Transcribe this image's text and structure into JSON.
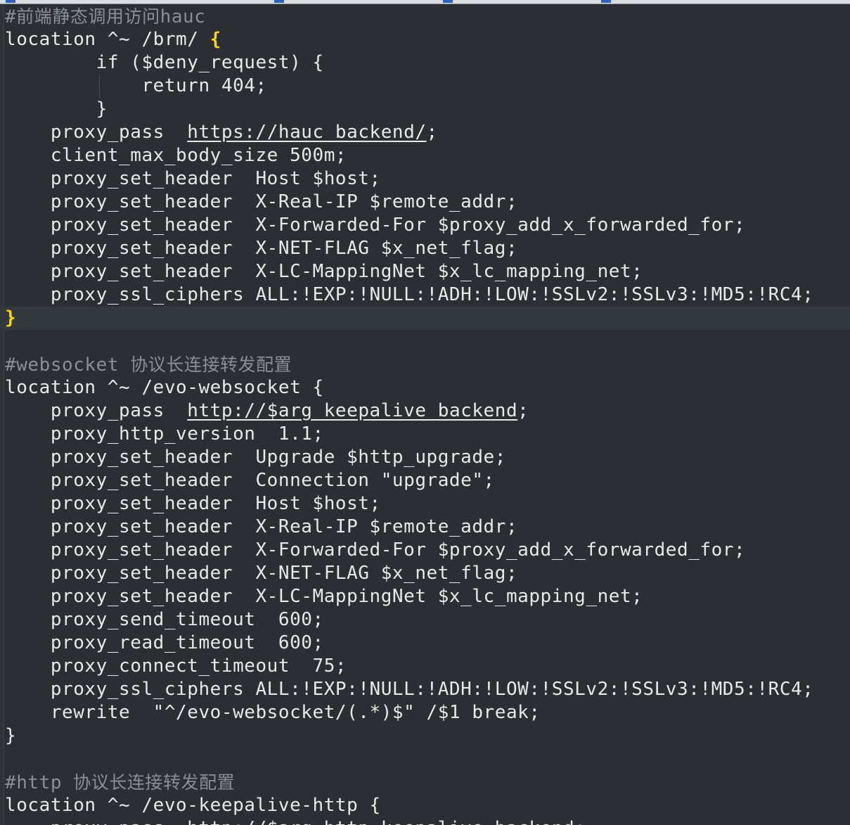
{
  "editor": {
    "lines": [
      {
        "parts": [
          {
            "t": "#",
            "c": "comment"
          },
          {
            "t": "前端静态调用访问",
            "c": "comment-cjk"
          },
          {
            "t": "hauc",
            "c": "comment"
          }
        ]
      },
      {
        "parts": [
          {
            "t": "location ^~ /brm/ "
          },
          {
            "t": "{",
            "c": "brace-hl"
          }
        ]
      },
      {
        "parts": [
          {
            "t": "        if ($deny_request) {"
          }
        ]
      },
      {
        "parts": [
          {
            "t": "            return 404;"
          }
        ]
      },
      {
        "parts": [
          {
            "t": "        }"
          }
        ]
      },
      {
        "parts": [
          {
            "t": "    proxy_pass  "
          },
          {
            "t": "https://hauc_backend/",
            "c": "url"
          },
          {
            "t": ";"
          }
        ]
      },
      {
        "parts": [
          {
            "t": "    client_max_body_size 500m;"
          }
        ]
      },
      {
        "parts": [
          {
            "t": "    proxy_set_header  Host $host;"
          }
        ]
      },
      {
        "parts": [
          {
            "t": "    proxy_set_header  X-Real-IP $remote_addr;"
          }
        ]
      },
      {
        "parts": [
          {
            "t": "    proxy_set_header  X-Forwarded-For $proxy_add_x_forwarded_for;"
          }
        ]
      },
      {
        "parts": [
          {
            "t": "    proxy_set_header  X-NET-FLAG $x_net_flag;"
          }
        ]
      },
      {
        "parts": [
          {
            "t": "    proxy_set_header  X-LC-MappingNet $x_lc_mapping_net;"
          }
        ]
      },
      {
        "parts": [
          {
            "t": "    proxy_ssl_ciphers ALL:!EXP:!NULL:!ADH:!LOW:!SSLv2:!SSLv3:!MD5:!RC4;"
          }
        ]
      },
      {
        "current": true,
        "parts": [
          {
            "t": "}",
            "c": "brace-hl"
          }
        ]
      },
      {
        "parts": [
          {
            "t": ""
          }
        ]
      },
      {
        "parts": [
          {
            "t": "#websocket ",
            "c": "comment"
          },
          {
            "t": "协议长连接转发配置",
            "c": "comment-cjk"
          }
        ]
      },
      {
        "parts": [
          {
            "t": "location ^~ /evo-websocket {"
          }
        ]
      },
      {
        "parts": [
          {
            "t": "    proxy_pass  "
          },
          {
            "t": "http://$arg_keepalive_backend",
            "c": "url"
          },
          {
            "t": ";"
          }
        ]
      },
      {
        "parts": [
          {
            "t": "    proxy_http_version  1.1;"
          }
        ]
      },
      {
        "parts": [
          {
            "t": "    proxy_set_header  Upgrade $http_upgrade;"
          }
        ]
      },
      {
        "parts": [
          {
            "t": "    proxy_set_header  Connection \"upgrade\";"
          }
        ]
      },
      {
        "parts": [
          {
            "t": "    proxy_set_header  Host $host;"
          }
        ]
      },
      {
        "parts": [
          {
            "t": "    proxy_set_header  X-Real-IP $remote_addr;"
          }
        ]
      },
      {
        "parts": [
          {
            "t": "    proxy_set_header  X-Forwarded-For $proxy_add_x_forwarded_for;"
          }
        ]
      },
      {
        "parts": [
          {
            "t": "    proxy_set_header  X-NET-FLAG $x_net_flag;"
          }
        ]
      },
      {
        "parts": [
          {
            "t": "    proxy_set_header  X-LC-MappingNet $x_lc_mapping_net;"
          }
        ]
      },
      {
        "parts": [
          {
            "t": "    proxy_send_timeout  600;"
          }
        ]
      },
      {
        "parts": [
          {
            "t": "    proxy_read_timeout  600;"
          }
        ]
      },
      {
        "parts": [
          {
            "t": "    proxy_connect_timeout  75;"
          }
        ]
      },
      {
        "parts": [
          {
            "t": "    proxy_ssl_ciphers ALL:!EXP:!NULL:!ADH:!LOW:!SSLv2:!SSLv3:!MD5:!RC4;"
          }
        ]
      },
      {
        "parts": [
          {
            "t": "    rewrite  \"^/evo-websocket/(.*)$\" /$1 break;"
          }
        ]
      },
      {
        "parts": [
          {
            "t": "}"
          }
        ]
      },
      {
        "parts": [
          {
            "t": ""
          }
        ]
      },
      {
        "parts": [
          {
            "t": "#http ",
            "c": "comment"
          },
          {
            "t": "协议长连接转发配置",
            "c": "comment-cjk"
          }
        ]
      },
      {
        "parts": [
          {
            "t": "location ^~ /evo-keepalive-http {"
          }
        ]
      },
      {
        "parts": [
          {
            "t": "    proxy_pass  "
          },
          {
            "t": "http://$arg_http_keepalive_backend",
            "c": "url"
          },
          {
            "t": ";"
          }
        ]
      }
    ]
  },
  "colors": {
    "background": "#2b2f33",
    "text": "#e8e8e8",
    "comment": "#8a8f95",
    "brace_match": "#ffd700"
  }
}
